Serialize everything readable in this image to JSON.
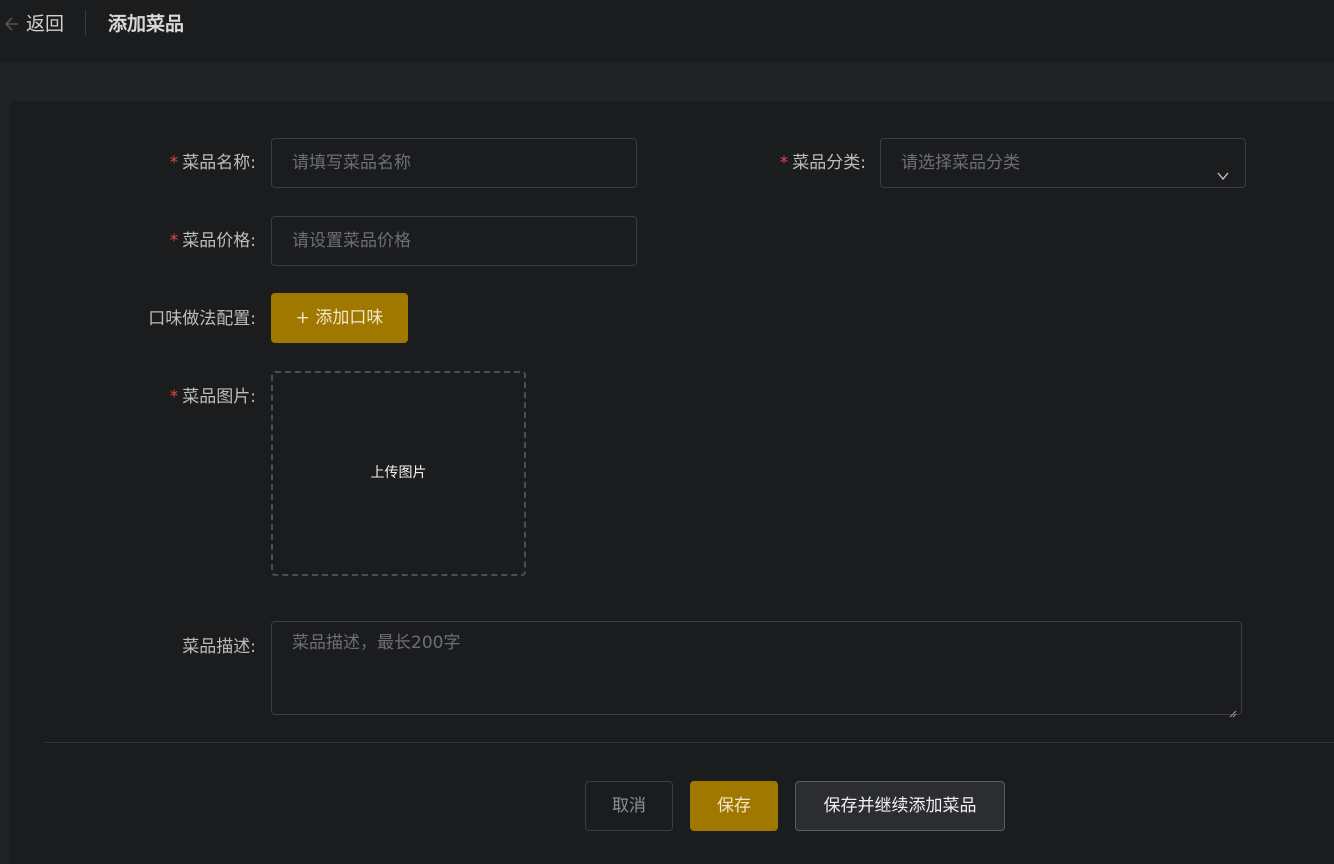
{
  "header": {
    "back_label": "返回",
    "title": "添加菜品"
  },
  "form": {
    "name": {
      "label": "菜品名称:",
      "required": "*",
      "placeholder": "请填写菜品名称"
    },
    "category": {
      "label": "菜品分类:",
      "required": "*",
      "placeholder": "请选择菜品分类"
    },
    "price": {
      "label": "菜品价格:",
      "required": "*",
      "placeholder": "请设置菜品价格"
    },
    "flavor": {
      "label": "口味做法配置:",
      "add_button": "+ 添加口味"
    },
    "image": {
      "label": "菜品图片:",
      "required": "*",
      "upload_text": "上传图片"
    },
    "description": {
      "label": "菜品描述:",
      "placeholder": "菜品描述，最长200字"
    }
  },
  "actions": {
    "cancel": "取消",
    "save": "保存",
    "save_and_continue": "保存并继续添加菜品"
  },
  "colors": {
    "accent": "#a07800",
    "required": "#e0483d",
    "background": "#1b1c1e"
  }
}
